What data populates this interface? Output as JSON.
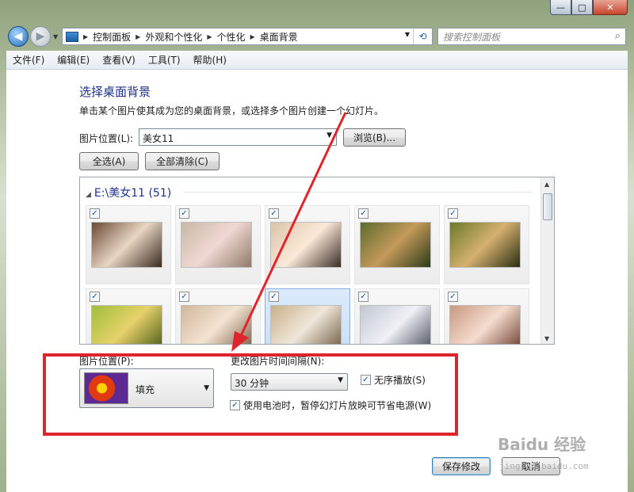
{
  "window": {
    "caption_buttons": {
      "minimize": "—",
      "maximize": "□",
      "close": "✕"
    }
  },
  "nav": {
    "back_icon": "back-arrow-icon",
    "forward_icon": "forward-arrow-icon",
    "breadcrumbs": [
      "控制面板",
      "外观和个性化",
      "个性化",
      "桌面背景"
    ],
    "search_placeholder": "搜索控制面板"
  },
  "menu": [
    "文件(F)",
    "编辑(E)",
    "查看(V)",
    "工具(T)",
    "帮助(H)"
  ],
  "page": {
    "heading": "选择桌面背景",
    "description": "单击某个图片使其成为您的桌面背景，或选择多个图片创建一个幻灯片。",
    "location_label": "图片位置(L):",
    "location_value": "美女11",
    "browse_label": "浏览(B)...",
    "select_all_label": "全选(A)",
    "clear_all_label": "全部清除(C)"
  },
  "gallery": {
    "group_title": "E:\\美女11 (51)",
    "tiles": [
      {
        "checked": "✓",
        "colors": [
          "#6a4a35",
          "#e8d6c2",
          "#3a2a20"
        ]
      },
      {
        "checked": "✓",
        "colors": [
          "#c7b8a8",
          "#f1d8d2",
          "#8f7a6a"
        ]
      },
      {
        "checked": "✓",
        "colors": [
          "#d9c3a8",
          "#fbe9d8",
          "#3b2d28"
        ]
      },
      {
        "checked": "✓",
        "colors": [
          "#5d6b2e",
          "#c49a5a",
          "#2c3a18"
        ]
      },
      {
        "checked": "✓",
        "colors": [
          "#6b7a2a",
          "#d6b070",
          "#2a2e12"
        ]
      },
      {
        "checked": "✓",
        "colors": [
          "#9fbf3a",
          "#e7d16a",
          "#4a5a18"
        ]
      },
      {
        "checked": "✓",
        "colors": [
          "#d1b79c",
          "#f3e3d2",
          "#7a5c44"
        ]
      },
      {
        "checked": "✓",
        "colors": [
          "#c9b08a",
          "#f0e7da",
          "#6e5a40"
        ]
      },
      {
        "checked": "✓",
        "colors": [
          "#c2c7d2",
          "#eef0f5",
          "#4a4f5c"
        ]
      },
      {
        "checked": "✓",
        "colors": [
          "#c79a80",
          "#f5dccf",
          "#6a3e2c"
        ]
      }
    ]
  },
  "position": {
    "label": "图片位置(P):",
    "value": "填充"
  },
  "interval": {
    "label": "更改图片时间间隔(N):",
    "value": "30 分钟",
    "shuffle_label": "无序播放(S)",
    "shuffle_checked": "✓",
    "battery_label": "使用电池时，暂停幻灯片放映可节省电源(W)",
    "battery_checked": "✓"
  },
  "actions": {
    "save_label": "保存修改",
    "cancel_label": "取消"
  },
  "watermark": {
    "main": "Baidu 经验",
    "sub": "jingyan.baidu.com"
  },
  "annotation_color": "#e0242c"
}
